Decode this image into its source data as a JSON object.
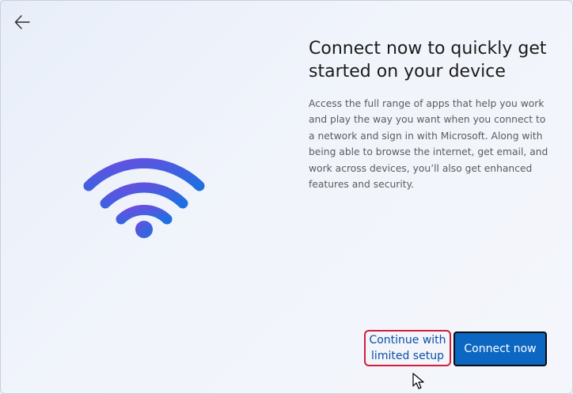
{
  "header": {
    "back_icon": "arrow-left-icon"
  },
  "illustration": {
    "icon": "wifi-icon",
    "colors": {
      "gradient_start": "#6a4ee0",
      "gradient_end": "#1f6fe0"
    }
  },
  "main": {
    "title": "Connect now to quickly get started on your device",
    "description": "Access the full range of apps that help you work and play the way you want when you connect to a network and sign in with Microsoft. Along with being able to browse the internet, get email, and work across devices, you’ll also get enhanced features and security."
  },
  "actions": {
    "limited_label": "Continue with limited setup",
    "connect_label": "Connect now",
    "accent_color": "#0b67c2",
    "highlight_color": "#d11e3a"
  }
}
